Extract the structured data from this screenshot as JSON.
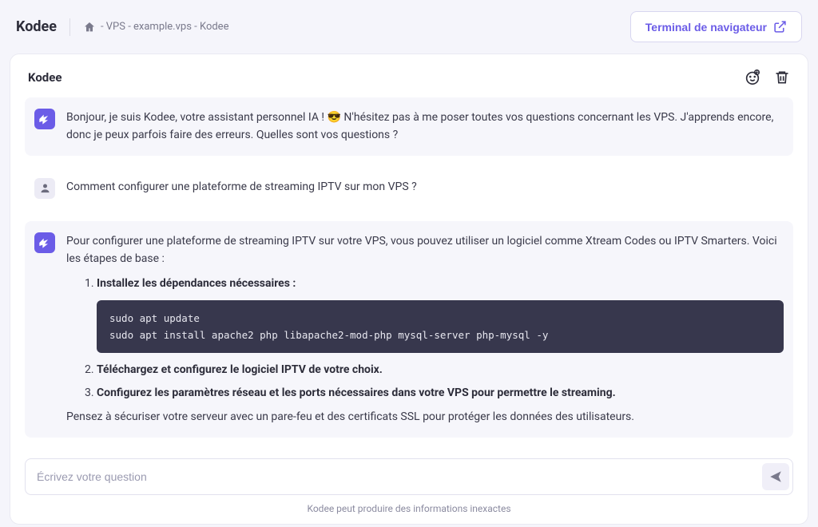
{
  "header": {
    "logo": "Kodee",
    "breadcrumb": " - VPS - example.vps - Kodee",
    "terminal_btn": "Terminal de navigateur"
  },
  "chat": {
    "title": "Kodee",
    "messages": {
      "bot_intro": "Bonjour, je suis Kodee, votre assistant personnel IA ! 😎 N'hésitez pas à me poser toutes vos questions concernant les VPS. J'apprends encore, donc je peux parfois faire des erreurs. Quelles sont vos questions ?",
      "user_question": "Comment configurer une plateforme de streaming IPTV sur mon VPS ?",
      "bot_answer_intro": "Pour configurer une plateforme de streaming IPTV sur votre VPS, vous pouvez utiliser un logiciel comme Xtream Codes ou IPTV Smarters. Voici les étapes de base :",
      "steps": {
        "s1": "Installez les dépendances nécessaires :",
        "s2": "Téléchargez et configurez le logiciel IPTV de votre choix.",
        "s3": "Configurez les paramètres réseau et les ports nécessaires dans votre VPS pour permettre le streaming."
      },
      "code": "sudo apt update\nsudo apt install apache2 php libapache2-mod-php mysql-server php-mysql -y",
      "bot_answer_footer": "Pensez à sécuriser votre serveur avec un pare-feu et des certificats SSL pour protéger les données des utilisateurs."
    }
  },
  "input": {
    "placeholder": "Écrivez votre question"
  },
  "disclaimer": "Kodee peut produire des informations inexactes"
}
